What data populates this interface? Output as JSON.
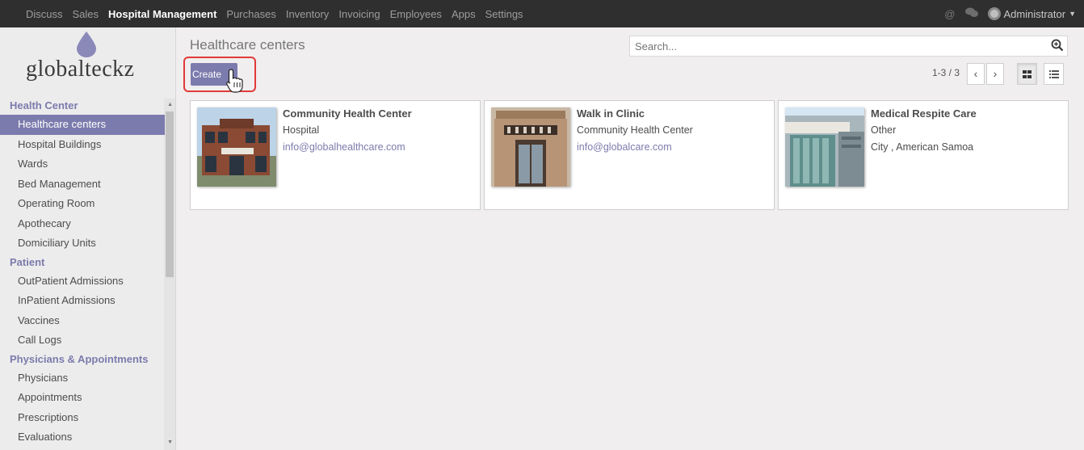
{
  "topbar": {
    "menu": [
      "Discuss",
      "Sales",
      "Hospital Management",
      "Purchases",
      "Inventory",
      "Invoicing",
      "Employees",
      "Apps",
      "Settings"
    ],
    "active_index": 2,
    "user": "Administrator"
  },
  "sidebar": {
    "logo_text": "globalteckz",
    "sections": [
      {
        "title": "Health Center",
        "items": [
          "Healthcare centers",
          "Hospital Buildings",
          "Wards",
          "Bed Management",
          "Operating Room",
          "Apothecary",
          "Domiciliary Units"
        ]
      },
      {
        "title": "Patient",
        "items": [
          "OutPatient Admissions",
          "InPatient Admissions",
          "Vaccines",
          "Call Logs"
        ]
      },
      {
        "title": "Physicians & Appointments",
        "items": [
          "Physicians",
          "Appointments",
          "Prescriptions",
          "Evaluations"
        ]
      }
    ],
    "active_item": "Healthcare centers"
  },
  "control": {
    "breadcrumb": "Healthcare centers",
    "search_placeholder": "Search...",
    "create_label": "Create",
    "pager": "1-3 / 3"
  },
  "cards": [
    {
      "name": "Community Health Center",
      "type": "Hospital",
      "detail": "info@globalhealthcare.com",
      "detail_is_link": true
    },
    {
      "name": "Walk in Clinic",
      "type": "Community Health Center",
      "detail": "info@globalcare.com",
      "detail_is_link": true
    },
    {
      "name": "Medical Respite Care",
      "type": "Other",
      "detail": "City , American Samoa",
      "detail_is_link": false
    }
  ],
  "colors": {
    "brand": "#7c7bad",
    "topbar": "#2f2f2f",
    "highlight": "#e23a3a"
  }
}
